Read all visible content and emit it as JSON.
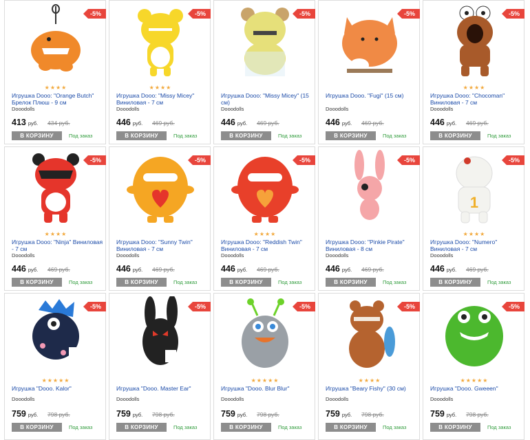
{
  "currency": "руб.",
  "cart_label": "В КОРЗИНУ",
  "availability_label": "Под заказ",
  "discount_label": "-5%",
  "brand": "Dooodolls",
  "rows": [
    [
      {
        "name": "Игрушка Dooo: \"Orange Butch\" Брелок Плюш - 9 см",
        "price": "413",
        "old_price": "434 руб.",
        "rating": 4,
        "toy_icon": "orange-dino-plush-icon",
        "color": "#f0892a"
      },
      {
        "name": "Игрушка Dooo: \"Missy Micey\" Виниловая - 7 см",
        "price": "446",
        "old_price": "469 руб.",
        "rating": 4,
        "toy_icon": "yellow-bear-vinyl-icon",
        "color": "#f7d72a"
      },
      {
        "name": "Игрушка Dooo: \"Missy Micey\" (15 см)",
        "price": "446",
        "old_price": "469 руб.",
        "rating": 0,
        "toy_icon": "yellow-bear-plush-icon",
        "color": "#e6e07a"
      },
      {
        "name": "Игрушка Dooo. \"Fugi\" (15 см)",
        "price": "446",
        "old_price": "469 руб.",
        "rating": 0,
        "toy_icon": "orange-cat-plush-icon",
        "color": "#f08a45"
      },
      {
        "name": "Игрушка Dooo: \"Chocoman\" Виниловая - 7 см",
        "price": "446",
        "old_price": "469 руб.",
        "rating": 4,
        "toy_icon": "brown-chocoman-icon",
        "color": "#a85a2a"
      }
    ],
    [
      {
        "name": "Игрушка Dooo: \"Ninja\" Виниловая - 7 см",
        "price": "446",
        "old_price": "469 руб.",
        "rating": 4,
        "toy_icon": "red-ninja-bear-icon",
        "color": "#e5352b"
      },
      {
        "name": "Игрушка Dooo: \"Sunny Twin\" Виниловая - 7 см",
        "price": "446",
        "old_price": "469 руб.",
        "rating": 0,
        "toy_icon": "orange-sunny-twin-icon",
        "color": "#f5a623"
      },
      {
        "name": "Игрушка Dooo: \"Reddish Twin\" Виниловая - 7 см",
        "price": "446",
        "old_price": "469 руб.",
        "rating": 4,
        "toy_icon": "red-reddish-twin-icon",
        "color": "#e8402a"
      },
      {
        "name": "Игрушка Dooo: \"Pinkie Pirate\" Виниловая - 8 см",
        "price": "446",
        "old_price": "469 руб.",
        "rating": 0,
        "toy_icon": "pink-bunny-pirate-icon",
        "color": "#f5a6a8"
      },
      {
        "name": "Игрушка Dooo: \"Numero\" Виниловая - 7 см",
        "price": "446",
        "old_price": "469 руб.",
        "rating": 4,
        "toy_icon": "white-numero-icon",
        "color": "#f3f3ef"
      }
    ],
    [
      {
        "name": "Игрушка \"Dooo. Kalor\"",
        "price": "759",
        "old_price": "798 руб.",
        "rating": 5,
        "toy_icon": "navy-kalor-plush-icon",
        "color": "#1e2a4a"
      },
      {
        "name": "Игрушка \"Dooo. Master Ear\"",
        "price": "759",
        "old_price": "798 руб.",
        "rating": 0,
        "toy_icon": "black-master-ear-plush-icon",
        "color": "#222222"
      },
      {
        "name": "Игрушка \"Dooo. Blur Blur\"",
        "price": "759",
        "old_price": "798 руб.",
        "rating": 5,
        "toy_icon": "grey-blur-blur-plush-icon",
        "color": "#9aa0a6"
      },
      {
        "name": "Игрушка \"Beary Fishy\" (30 см)",
        "price": "759",
        "old_price": "798 руб.",
        "rating": 4,
        "toy_icon": "brown-beary-fishy-plush-icon",
        "color": "#b5632f"
      },
      {
        "name": "Игрушка \"Dooo. Gweeen\"",
        "price": "759",
        "old_price": "798 руб.",
        "rating": 5,
        "toy_icon": "green-gweeen-plush-icon",
        "color": "#4cb82e"
      }
    ]
  ]
}
